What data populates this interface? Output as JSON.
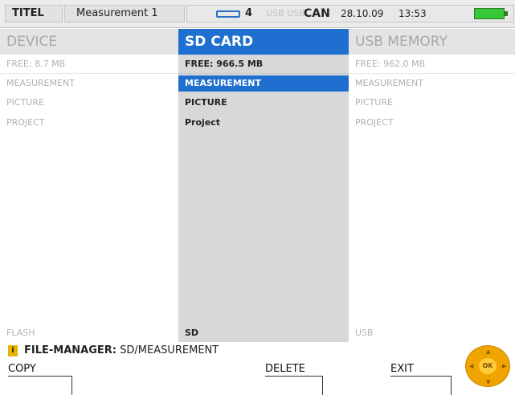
{
  "status_bar": {
    "device_label": "TITEL",
    "title": "Measurement 1",
    "battery_count": "4",
    "usb_indicator": "USB USB",
    "can_label": "CAN",
    "date": "28.10.09",
    "time": "13:53",
    "battery_color": "#37c837"
  },
  "columns": {
    "device": {
      "header": "DEVICE",
      "free": "FREE: 8.7 MB",
      "items": [
        "MEASUREMENT",
        "PICTURE",
        "PROJECT"
      ],
      "footer": "FLASH"
    },
    "sd": {
      "header": "SD CARD",
      "free": "FREE: 966.5 MB",
      "items": [
        "MEASUREMENT",
        "PICTURE",
        "Project"
      ],
      "footer": "SD"
    },
    "usb": {
      "header": "USB MEMORY",
      "free": "FREE: 962.0 MB",
      "items": [
        "MEASUREMENT",
        "PICTURE",
        "PROJECT"
      ],
      "footer": "USB"
    }
  },
  "status_line": {
    "info_icon": "i",
    "label": "FILE-MANAGER:",
    "path": "SD/MEASUREMENT"
  },
  "softkeys": {
    "copy": "COPY",
    "delete": "DELETE",
    "exit": "EXIT"
  },
  "navpad": {
    "ok_label": "OK"
  },
  "colors": {
    "accent": "#1e6fcf",
    "navpad": "#f0a400"
  }
}
